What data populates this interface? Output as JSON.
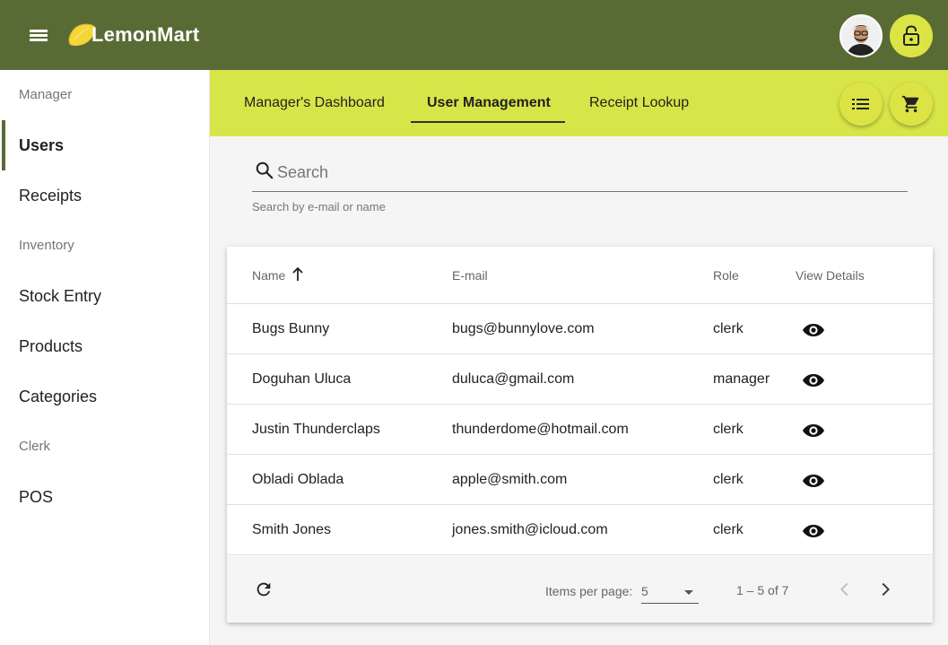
{
  "app": {
    "title": "LemonMart",
    "colors": {
      "toolbar": "#596b34",
      "accent": "#d8e548",
      "fab": "#dce445"
    }
  },
  "toolbar": {
    "menu_icon": "menu-icon",
    "logo_icon": "lemon-icon",
    "avatar_icon": "user-avatar",
    "lock_icon": "lock-open-icon"
  },
  "sidebar": {
    "sections": [
      {
        "header": "Manager",
        "items": [
          "Users",
          "Receipts"
        ]
      },
      {
        "header": "Inventory",
        "items": [
          "Stock Entry",
          "Products",
          "Categories"
        ]
      },
      {
        "header": "Clerk",
        "items": [
          "POS"
        ]
      }
    ],
    "active": "Users"
  },
  "tabs": {
    "items": [
      "Manager's Dashboard",
      "User Management",
      "Receipt Lookup"
    ],
    "active": "User Management",
    "actions": [
      "list-icon",
      "cart-icon"
    ]
  },
  "search": {
    "placeholder": "Search",
    "hint": "Search by e-mail or name"
  },
  "table": {
    "columns": [
      "Name",
      "E-mail",
      "Role",
      "View Details"
    ],
    "sort": {
      "column": "Name",
      "direction": "ascending",
      "icon": "arrow-up-icon"
    },
    "rows": [
      {
        "name": "Bugs Bunny",
        "email": "bugs@bunnylove.com",
        "role": "clerk"
      },
      {
        "name": "Doguhan Uluca",
        "email": "duluca@gmail.com",
        "role": "manager"
      },
      {
        "name": "Justin Thunderclaps",
        "email": "thunderdome@hotmail.com",
        "role": "clerk"
      },
      {
        "name": "Obladi Oblada",
        "email": "apple@smith.com",
        "role": "clerk"
      },
      {
        "name": "Smith Jones",
        "email": "jones.smith@icloud.com",
        "role": "clerk"
      }
    ],
    "view_icon": "eye-icon"
  },
  "paginator": {
    "refresh_icon": "refresh-icon",
    "items_per_page_label": "Items per page:",
    "items_per_page_value": "5",
    "range_label": "1 – 5 of 7",
    "prev_icon": "chevron-left-icon",
    "next_icon": "chevron-right-icon"
  }
}
